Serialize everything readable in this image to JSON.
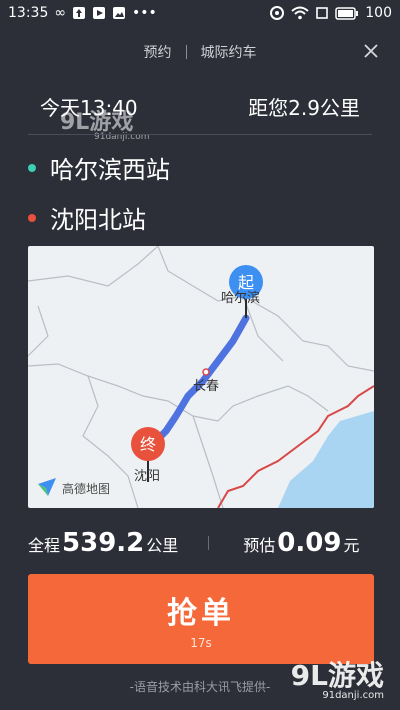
{
  "status": {
    "time": "13:35",
    "battery": "100"
  },
  "tabs": {
    "reserve": "预约",
    "intercity": "城际约车"
  },
  "trip": {
    "time": "今天13:40",
    "distance": "距您2.9公里"
  },
  "stops": [
    {
      "name": "哈尔滨西站",
      "color": "#3ccfb3"
    },
    {
      "name": "沈阳北站",
      "color": "#e8513c"
    }
  ],
  "map": {
    "provider": "高德地图",
    "start_badge": "起",
    "end_badge": "终",
    "start_city": "哈尔滨",
    "mid_city": "长春",
    "end_city": "沈阳",
    "route_color": "#4e72e0"
  },
  "summary": {
    "total_prefix": "全程",
    "total_value": "539.2",
    "total_unit": "公里",
    "est_prefix": "预估",
    "est_value": "0.09",
    "est_unit": "元"
  },
  "grab": {
    "label": "抢单",
    "countdown": "17s"
  },
  "footer": {
    "credit": "-语音技术由科大讯飞提供-"
  },
  "watermark": {
    "brand": "9L游戏",
    "site": "91danji.com"
  }
}
